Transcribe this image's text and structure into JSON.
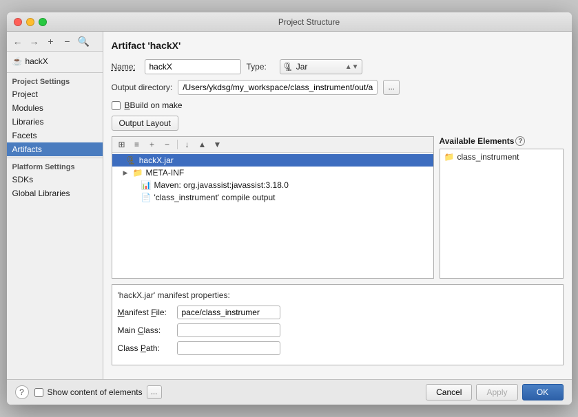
{
  "window": {
    "title": "Project Structure"
  },
  "left_panel": {
    "toolbar": {
      "add": "+",
      "remove": "−",
      "zoom": "⊕"
    },
    "tree_items": [
      {
        "label": "hackX",
        "icon": "☕"
      }
    ],
    "section_project": "Project Settings",
    "nav_items": [
      {
        "id": "project",
        "label": "Project"
      },
      {
        "id": "modules",
        "label": "Modules"
      },
      {
        "id": "libraries",
        "label": "Libraries"
      },
      {
        "id": "facets",
        "label": "Facets"
      },
      {
        "id": "artifacts",
        "label": "Artifacts",
        "active": true
      }
    ],
    "section_platform": "Platform Settings",
    "platform_items": [
      {
        "id": "sdks",
        "label": "SDKs"
      },
      {
        "id": "global_libraries",
        "label": "Global Libraries"
      }
    ]
  },
  "right_panel": {
    "title": "Artifact 'hackX'",
    "name_label": "Name:",
    "name_value": "hackX",
    "type_label": "Type:",
    "type_icon": "🗜",
    "type_value": "Jar",
    "output_dir_label": "Output directory:",
    "output_dir_value": "/Users/ykdsg/my_workspace/class_instrument/out/artif",
    "output_dir_btn": "...",
    "build_on_make_label": "Build on make",
    "output_layout_btn": "Output Layout",
    "toolbar": {
      "btn1": "⊞",
      "btn2": "≡",
      "btn3": "+",
      "btn4": "−",
      "btn5": "↓",
      "btn6": "▲",
      "btn7": "▼"
    },
    "tree_nodes": [
      {
        "id": "hackx-jar",
        "label": "hackX.jar",
        "icon": "🗜",
        "indent": 0,
        "selected": true,
        "arrow": ""
      },
      {
        "id": "meta-inf",
        "label": "META-INF",
        "icon": "📁",
        "indent": 1,
        "arrow": "▶"
      },
      {
        "id": "maven",
        "label": "Maven: org.javassist:javassist:3.18.0",
        "icon": "📊",
        "indent": 2,
        "arrow": ""
      },
      {
        "id": "compile",
        "label": "'class_instrument' compile output",
        "icon": "📄",
        "indent": 2,
        "arrow": ""
      }
    ],
    "available_elements_label": "Available Elements",
    "available_nodes": [
      {
        "id": "class-instrument",
        "label": "class_instrument",
        "icon": "📁",
        "indent": 0
      }
    ],
    "manifest_title": "'hackX.jar' manifest properties:",
    "manifest_file_label": "Manifest File:",
    "manifest_file_value": "pace/class_instrumer",
    "main_class_label": "Main Class:",
    "main_class_value": "",
    "class_path_label": "Class Path:",
    "class_path_value": "",
    "show_content_label": "Show content of elements",
    "show_content_btn": "...",
    "cancel_btn": "Cancel",
    "apply_btn": "Apply",
    "ok_btn": "OK",
    "help_label": "?"
  }
}
